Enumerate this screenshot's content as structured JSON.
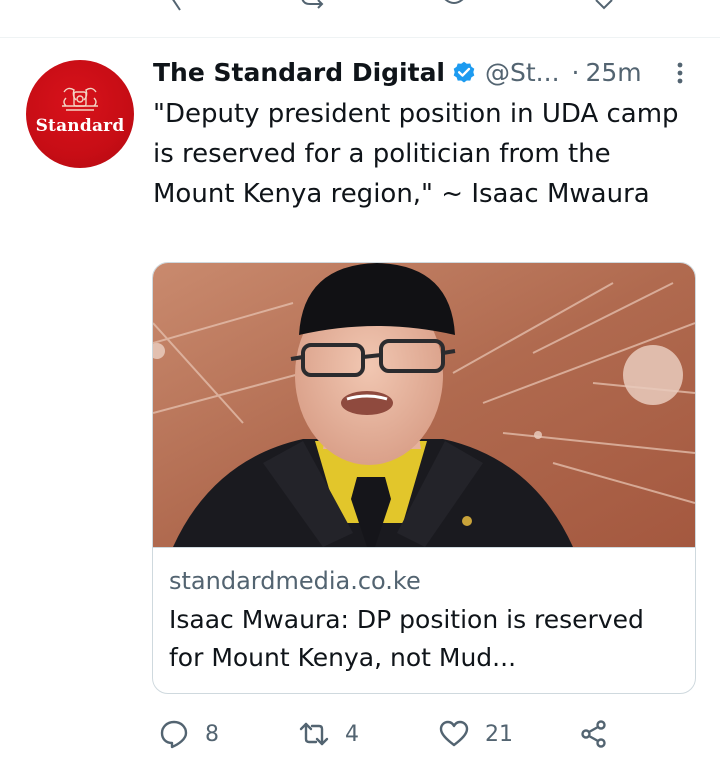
{
  "tweet": {
    "author_name": "The Standard Digital",
    "author_handle": "@St...",
    "separator": "·",
    "timestamp": "25m",
    "avatar_text": "Standard",
    "text": "\"Deputy president position in UDA camp is reserved for a politician from the Mount Kenya region,\" ~ Isaac Mwaura",
    "card": {
      "domain": "standardmedia.co.ke",
      "title": "Isaac Mwaura: DP position is reserved for Mount Kenya, not Mud..."
    },
    "actions": {
      "replies": "8",
      "retweets": "4",
      "likes": "21"
    }
  },
  "icons": {
    "verified": "verified-badge-icon",
    "more": "more-options-icon",
    "reply": "reply-icon",
    "retweet": "retweet-icon",
    "like": "heart-icon",
    "share": "share-icon"
  },
  "colors": {
    "brand_red": "#c70d15",
    "verified_blue": "#1d9bf0",
    "secondary_text": "#536471",
    "primary_text": "#0f1419"
  }
}
